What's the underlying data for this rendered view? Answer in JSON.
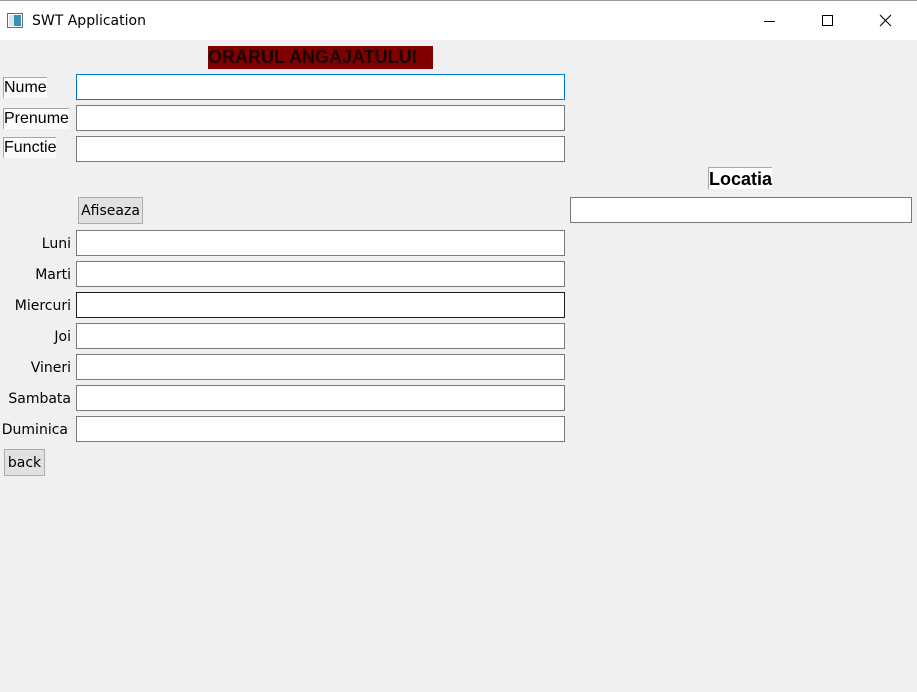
{
  "window": {
    "title": "SWT Application",
    "icon": "window-app-icon",
    "controls": {
      "minimize": "minimize-icon",
      "maximize": "maximize-icon",
      "close": "close-icon"
    }
  },
  "form": {
    "heading": "ORARUL ANGAJATULUI",
    "heading_bg": "#800000",
    "nume_label": "Nume",
    "nume_value": "",
    "prenume_label": "Prenume",
    "prenume_value": "",
    "functie_label": "Functie",
    "functie_value": "",
    "show_button": "Afiseaza",
    "back_button": "back"
  },
  "location": {
    "label": "Locatia",
    "value": ""
  },
  "schedule": {
    "days": [
      {
        "label": "Luni",
        "value": ""
      },
      {
        "label": "Marti",
        "value": ""
      },
      {
        "label": "Miercuri",
        "value": ""
      },
      {
        "label": "Joi",
        "value": ""
      },
      {
        "label": "Vineri",
        "value": ""
      },
      {
        "label": "Sambata",
        "value": ""
      },
      {
        "label": "Duminica",
        "value": ""
      }
    ]
  },
  "colors": {
    "focus_border": "#0078d7",
    "background": "#f0f0f0"
  }
}
